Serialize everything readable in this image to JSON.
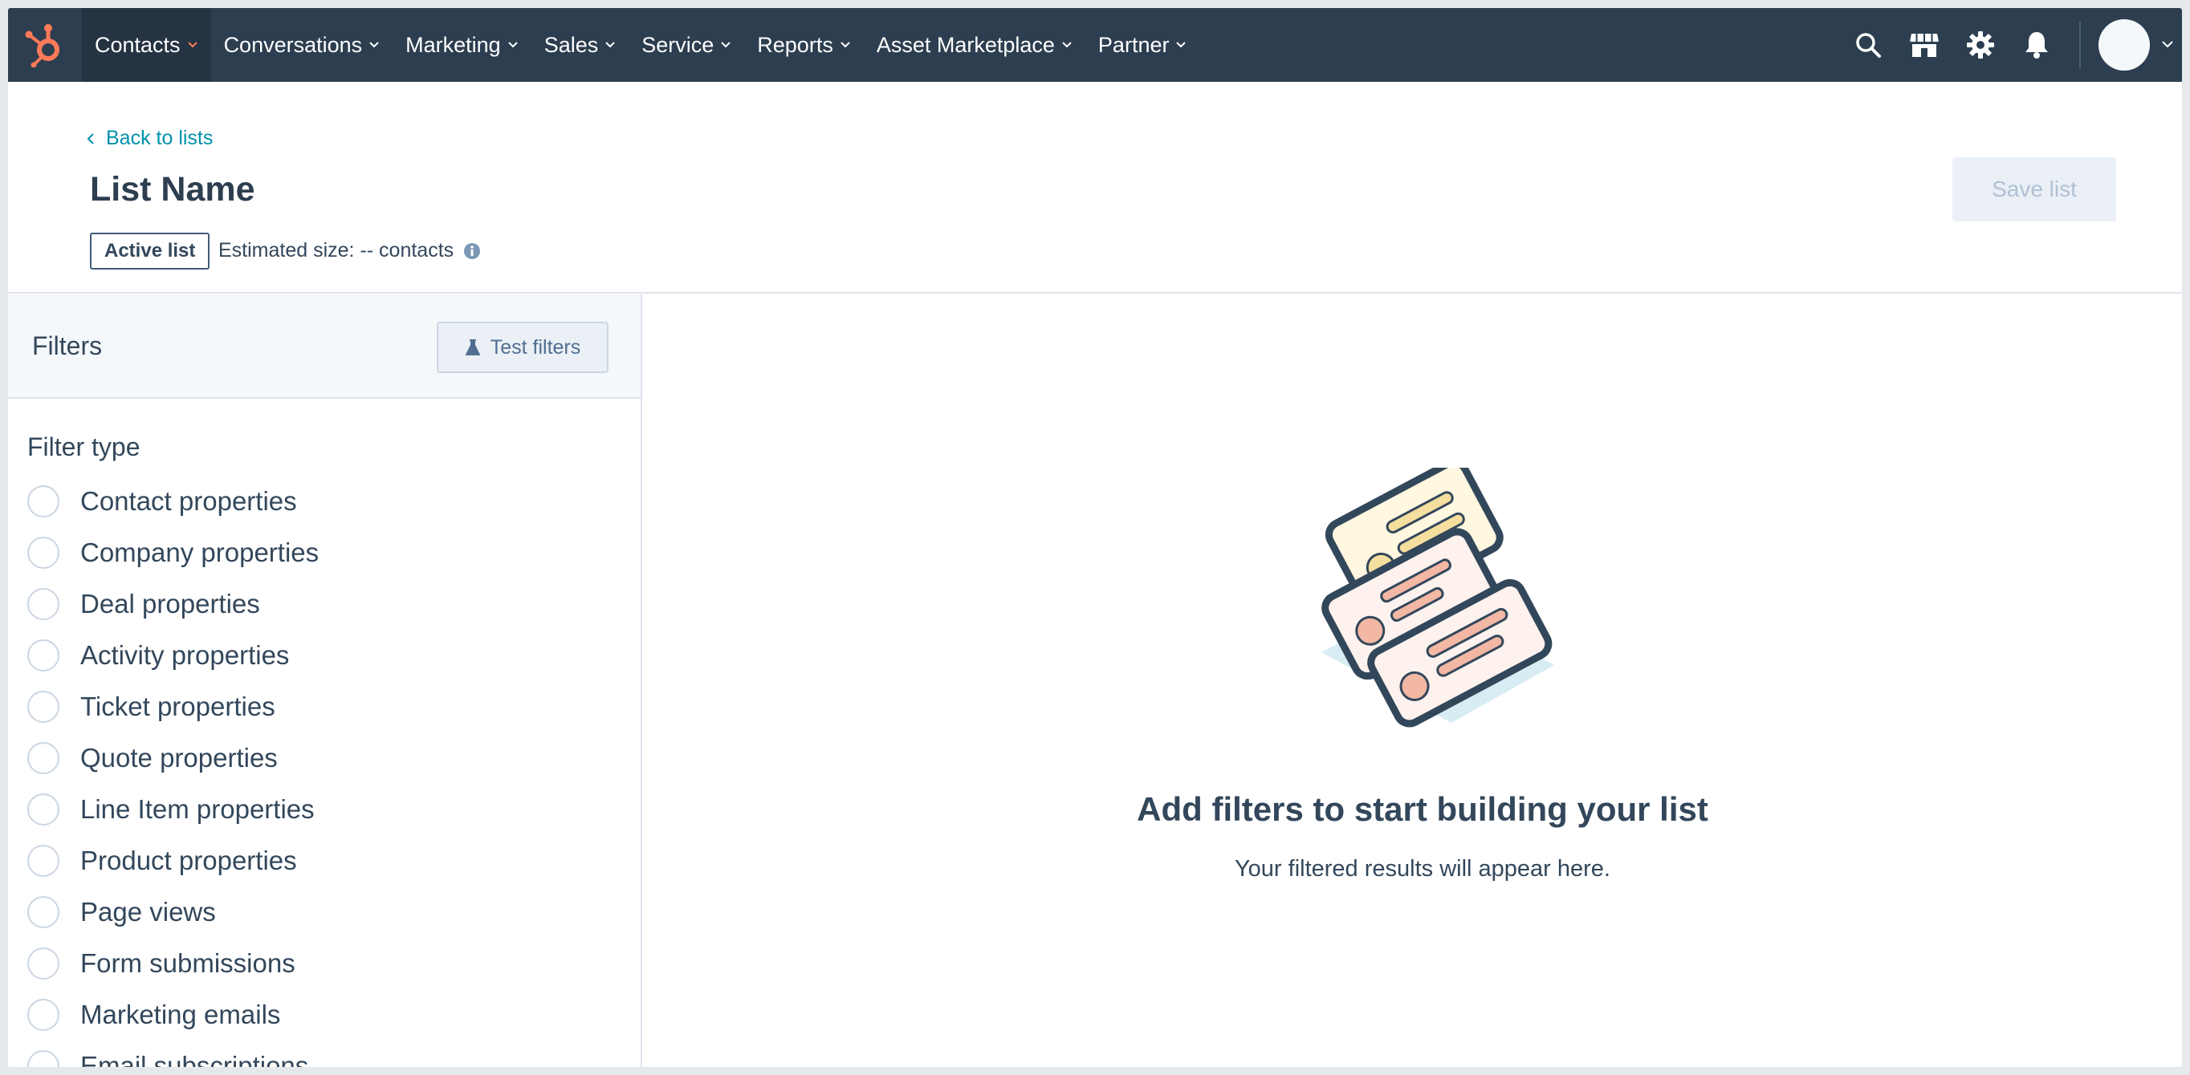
{
  "nav": {
    "items": [
      {
        "label": "Contacts",
        "active": true
      },
      {
        "label": "Conversations"
      },
      {
        "label": "Marketing"
      },
      {
        "label": "Sales"
      },
      {
        "label": "Service"
      },
      {
        "label": "Reports"
      },
      {
        "label": "Asset Marketplace"
      },
      {
        "label": "Partner"
      }
    ],
    "icons": [
      "search-icon",
      "marketplace-icon",
      "gear-icon",
      "bell-icon"
    ],
    "colors": {
      "bar": "#2d3e50",
      "active": "#253342",
      "logo": "#ff7a59"
    }
  },
  "header": {
    "back_label": "Back to lists",
    "title": "List Name",
    "badge": "Active list",
    "estimated_size": "Estimated size: -- contacts",
    "save_label": "Save list"
  },
  "filters": {
    "title": "Filters",
    "test_label": "Test filters",
    "type_title": "Filter type",
    "types": [
      "Contact properties",
      "Company properties",
      "Deal properties",
      "Activity properties",
      "Ticket properties",
      "Quote properties",
      "Line Item properties",
      "Product properties",
      "Page views",
      "Form submissions",
      "Marketing emails",
      "Email subscriptions"
    ]
  },
  "empty_state": {
    "title": "Add filters to start building your list",
    "subtitle": "Your filtered results will appear here."
  }
}
